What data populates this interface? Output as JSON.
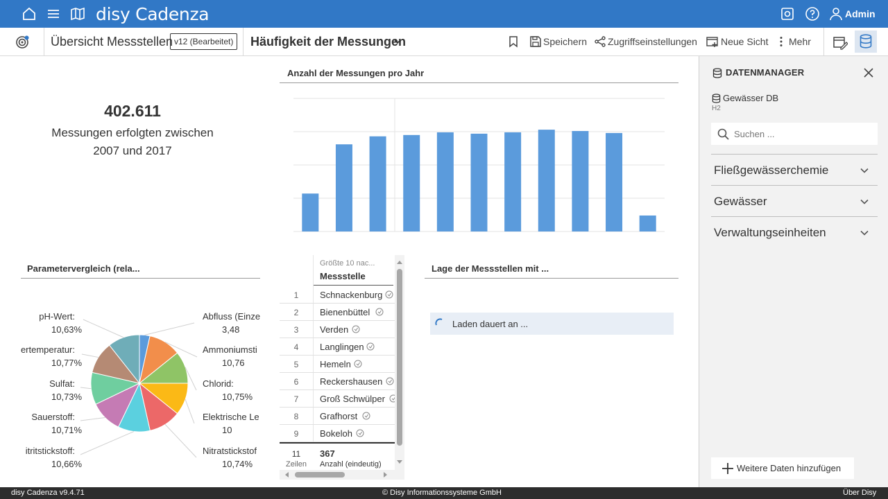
{
  "topbar": {
    "brand": "disy Cadenza",
    "user": "Admin",
    "accent_color": "#3178c6",
    "icons": [
      "home-icon",
      "menu-icon",
      "map-icon",
      "settings-icon",
      "help-icon",
      "user-icon"
    ]
  },
  "subbar": {
    "workbook_title": "Übersicht Messstellen",
    "version_badge": "v12 (Bearbeitet)",
    "view_title": "Häufigkeit der Messungen",
    "save": "Speichern",
    "access": "Zugriffseinstellungen",
    "new_view": "Neue Sicht",
    "more": "Mehr"
  },
  "kpi": {
    "value": "402.611",
    "line1": "Messungen erfolgten zwischen",
    "line2": "2007 und 2017"
  },
  "bar_panel": {
    "title": "Anzahl der Messungen pro Jahr"
  },
  "pie_panel": {
    "title": "Parametervergleich (rela..."
  },
  "table_panel": {
    "header_small": "Größte 10 nac...",
    "header_main": "Messstelle",
    "rows": [
      {
        "num": "1",
        "name": "Schnackenburg"
      },
      {
        "num": "2",
        "name": "Bienenbüttel"
      },
      {
        "num": "3",
        "name": "Verden"
      },
      {
        "num": "4",
        "name": "Langlingen"
      },
      {
        "num": "5",
        "name": "Hemeln"
      },
      {
        "num": "6",
        "name": "Reckershausen"
      },
      {
        "num": "7",
        "name": "Groß Schwülper"
      },
      {
        "num": "8",
        "name": "Grafhorst"
      },
      {
        "num": "9",
        "name": "Bokeloh"
      }
    ],
    "footer_count": "11",
    "footer_count_label": "Zeilen",
    "footer_value": "367",
    "footer_value_label": "Anzahl (eindeutig)"
  },
  "map_panel": {
    "title": "Lage der Messstellen mit ...",
    "loading": "Laden dauert an ..."
  },
  "side": {
    "title": "DATENMANAGER",
    "db_name": "Gewässer DB",
    "db_sub": "H2",
    "search_placeholder": "Suchen ...",
    "sections": [
      "Fließgewässerchemie",
      "Gewässer",
      "Verwaltungseinheiten"
    ],
    "add_button": "Weitere Daten hinzufügen"
  },
  "footer": {
    "left": "disy Cadenza v9.4.71",
    "center": "© Disy Informationssysteme GmbH",
    "right": "Über Disy"
  },
  "chart_data": [
    {
      "type": "bar",
      "title": "Anzahl der Messungen pro Jahr",
      "categories": [
        "",
        "",
        "",
        "",
        "",
        "",
        "",
        "",
        "",
        "",
        ""
      ],
      "values": [
        57,
        131,
        143,
        145,
        149,
        147,
        149,
        153,
        151,
        148,
        24
      ],
      "ylim": [
        0,
        200
      ],
      "grid": true,
      "color": "#5b9bdc"
    },
    {
      "type": "pie",
      "title": "Parametervergleich (rela...",
      "slices": [
        {
          "label": "Abfluss (Einze",
          "value_label": "3,48",
          "value": 3.48,
          "color": "#5b9bdc"
        },
        {
          "label": "Ammoniumsti",
          "value_label": "10,76",
          "value": 10.76,
          "color": "#f28e4b"
        },
        {
          "label": "Chlorid:",
          "value_label": "10,75%",
          "value": 10.75,
          "color": "#8fc466"
        },
        {
          "label": "Elektrische Le",
          "value_label": "10",
          "value": 10.75,
          "color": "#fbb916"
        },
        {
          "label": "Nitratstickstof",
          "value_label": "10,74%",
          "value": 10.74,
          "color": "#ec6868"
        },
        {
          "label": "itritstickstoff:",
          "value_label": "10,66%",
          "value": 10.66,
          "color": "#5bd0df"
        },
        {
          "label": "Sauerstoff:",
          "value_label": "10,71%",
          "value": 10.71,
          "color": "#c57bb4"
        },
        {
          "label": "Sulfat:",
          "value_label": "10,73%",
          "value": 10.73,
          "color": "#6fce9f"
        },
        {
          "label": "ertemperatur:",
          "value_label": "10,77%",
          "value": 10.77,
          "color": "#b58a74"
        },
        {
          "label": "pH-Wert:",
          "value_label": "10,63%",
          "value": 10.63,
          "color": "#6fadb8"
        }
      ]
    }
  ]
}
